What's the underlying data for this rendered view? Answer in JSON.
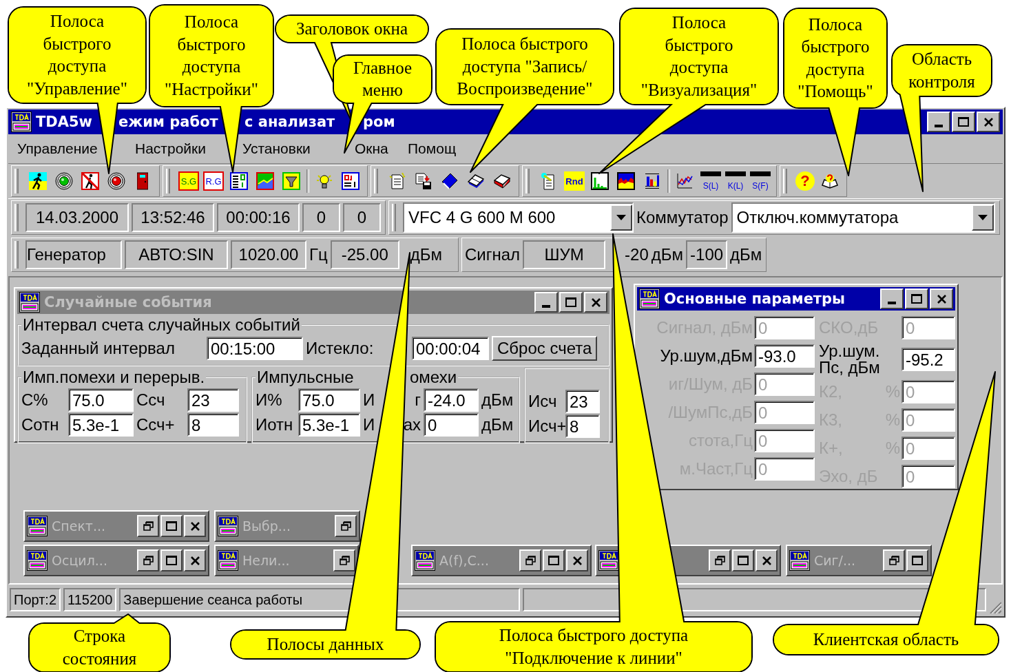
{
  "window": {
    "title_parts": [
      "TDA5w",
      "ежим работ",
      "с анализат",
      "ром"
    ]
  },
  "menu": [
    "Управление",
    "Настройки",
    "Установки",
    "Окна",
    "Помощ"
  ],
  "toolbar": {
    "groups": [
      {
        "items": [
          {
            "kind": "walk"
          },
          {
            "kind": "greenlamp"
          },
          {
            "kind": "nowalk"
          },
          {
            "kind": "redlamp"
          },
          {
            "kind": "door"
          }
        ]
      },
      {
        "items": [
          {
            "kind": "sg",
            "label": "S.G"
          },
          {
            "kind": "rg",
            "label": "R.G"
          },
          {
            "kind": "list"
          },
          {
            "kind": "picture"
          },
          {
            "kind": "funnel"
          },
          {
            "kind": "separator"
          },
          {
            "kind": "bulb"
          },
          {
            "kind": "form"
          }
        ]
      },
      {
        "items": [
          {
            "kind": "newdoc"
          },
          {
            "kind": "savedoc"
          },
          {
            "kind": "book"
          },
          {
            "kind": "openbook"
          },
          {
            "kind": "eraser"
          }
        ]
      },
      {
        "items": [
          {
            "kind": "wand"
          },
          {
            "kind": "rnd",
            "label": "Rnd"
          },
          {
            "kind": "barchart"
          },
          {
            "kind": "areachart"
          },
          {
            "kind": "colorbars"
          },
          {
            "kind": "separator"
          },
          {
            "kind": "linechart"
          },
          {
            "kind": "scale",
            "label": "S(L)"
          },
          {
            "kind": "scale",
            "label": "K(L)"
          },
          {
            "kind": "scale",
            "label": "S(F)"
          }
        ]
      },
      {
        "items": [
          {
            "kind": "help",
            "label": "?"
          },
          {
            "kind": "helpbook"
          }
        ]
      }
    ]
  },
  "data_bar_1": {
    "cells": [
      "14.03.2000",
      "13:52:46",
      "00:00:16",
      "0",
      "0"
    ],
    "line_combo": "VFC 4 G 600 M 600",
    "switch_label": "Коммутатор",
    "switch_combo": "Отключ.коммутатора"
  },
  "data_bar_2": {
    "generator": {
      "label": "Генератор",
      "mode": "АВТО:SIN",
      "frequency": "1020.00",
      "frequency_unit": "Гц",
      "amplitude": "-25.00",
      "amplitude_unit": "дБм"
    },
    "signal": {
      "label": "Сигнал",
      "type": "ШУМ",
      "amplitude": "-20",
      "amplitude_unit": "дБм",
      "floor": "-100",
      "floor_unit": "дБм"
    }
  },
  "random_events": {
    "title": "Случайные события",
    "active": false,
    "interval_group": {
      "title": "Интервал счета случайных событий",
      "set_label": "Заданный интервал",
      "set_value": "00:15:00",
      "elapsed_label": "Истекло:",
      "elapsed_value": "00:00:04",
      "reset_button": "Сброс счета"
    },
    "imp_group": {
      "title": "Имп.помехи  и перерыв.",
      "rows": [
        {
          "label": "С%",
          "value": "75.0",
          "label2": "Ссч",
          "value2": "23"
        },
        {
          "label": "Сотн",
          "value": "5.3e-1",
          "label2": "Ссч+",
          "value2": "8"
        }
      ]
    },
    "pulse_group": {
      "title_parts": [
        "Импульсные",
        "омехи"
      ],
      "rows": [
        {
          "label": "И%",
          "value": "75.0",
          "label2_parts": [
            "И",
            "г"
          ],
          "value2": "-24.0",
          "unit": "дБм"
        },
        {
          "label": "Иотн",
          "value": "5.3e-1",
          "label2_parts": [
            "И",
            "ах"
          ],
          "value2": "0",
          "unit": "дБм"
        }
      ]
    },
    "count_group": {
      "rows": [
        {
          "label": "Исч",
          "value": "23"
        },
        {
          "label": "Исч+",
          "value": "8"
        }
      ]
    }
  },
  "main_params": {
    "title": "Основные параметры",
    "active": true,
    "left_rows": [
      {
        "label": "Сигнал, дБм",
        "value": "0",
        "disabled": true
      },
      {
        "label": "Ур.шум,дБм",
        "value": "-93.0",
        "disabled": false
      },
      {
        "label": "иг/Шум, дБ",
        "value": "0",
        "disabled": true
      },
      {
        "label": "/ШумПс,дБ",
        "value": "0",
        "disabled": true
      },
      {
        "label": "стота,Гц",
        "value": "0",
        "disabled": true
      },
      {
        "label": "м.Част,Гц",
        "value": "0",
        "disabled": true
      }
    ],
    "right_rows": [
      {
        "label": "СКО,дБ",
        "value": "0",
        "disabled": true
      },
      {
        "label": "Ур.шум. Пс, дБм",
        "value": "-95.2",
        "disabled": false
      },
      {
        "label": "К2,",
        "unit": "%",
        "value": "0",
        "disabled": true
      },
      {
        "label": "К3,",
        "unit": "%",
        "value": "0",
        "disabled": true
      },
      {
        "label": "К+,",
        "unit": "%",
        "value": "0",
        "disabled": true
      },
      {
        "label": "Эхо, дБ",
        "value": "0",
        "disabled": true
      }
    ]
  },
  "minimized_rows": [
    [
      {
        "title": "Спект..."
      },
      {
        "title": "Выбр..."
      }
    ],
    [
      {
        "title": "Осцил..."
      },
      {
        "title": "Нели..."
      },
      {
        "title": "A(f),C..."
      },
      {},
      {
        "title": "Сиг/..."
      }
    ]
  ],
  "status_bar": [
    "Порт:2",
    "115200",
    "Завершение сеанса работы"
  ],
  "callouts": [
    {
      "text": "Полоса\nбыстрого\nдоступа\n\"Управление\""
    },
    {
      "text": "Полоса\nбыстрого\nдоступа\n\"Настройки\""
    },
    {
      "text": "Заголовок окна"
    },
    {
      "text": "Главное\nменю"
    },
    {
      "text": "Полоса быстрого\nдоступа \"Запись/\nВоспроизведение\""
    },
    {
      "text": "Полоса\nбыстрого\nдоступа\n\"Визуализация\""
    },
    {
      "text": "Полоса\nбыстрого\nдоступа\n\"Помощь\""
    },
    {
      "text": "Область\nконтроля"
    },
    {
      "text": "Строка\nсостояния"
    },
    {
      "text": "Полосы данных"
    },
    {
      "text": "Полоса быстрого доступа\n\"Подключение к линии\""
    },
    {
      "text": "Клиентская область"
    }
  ]
}
